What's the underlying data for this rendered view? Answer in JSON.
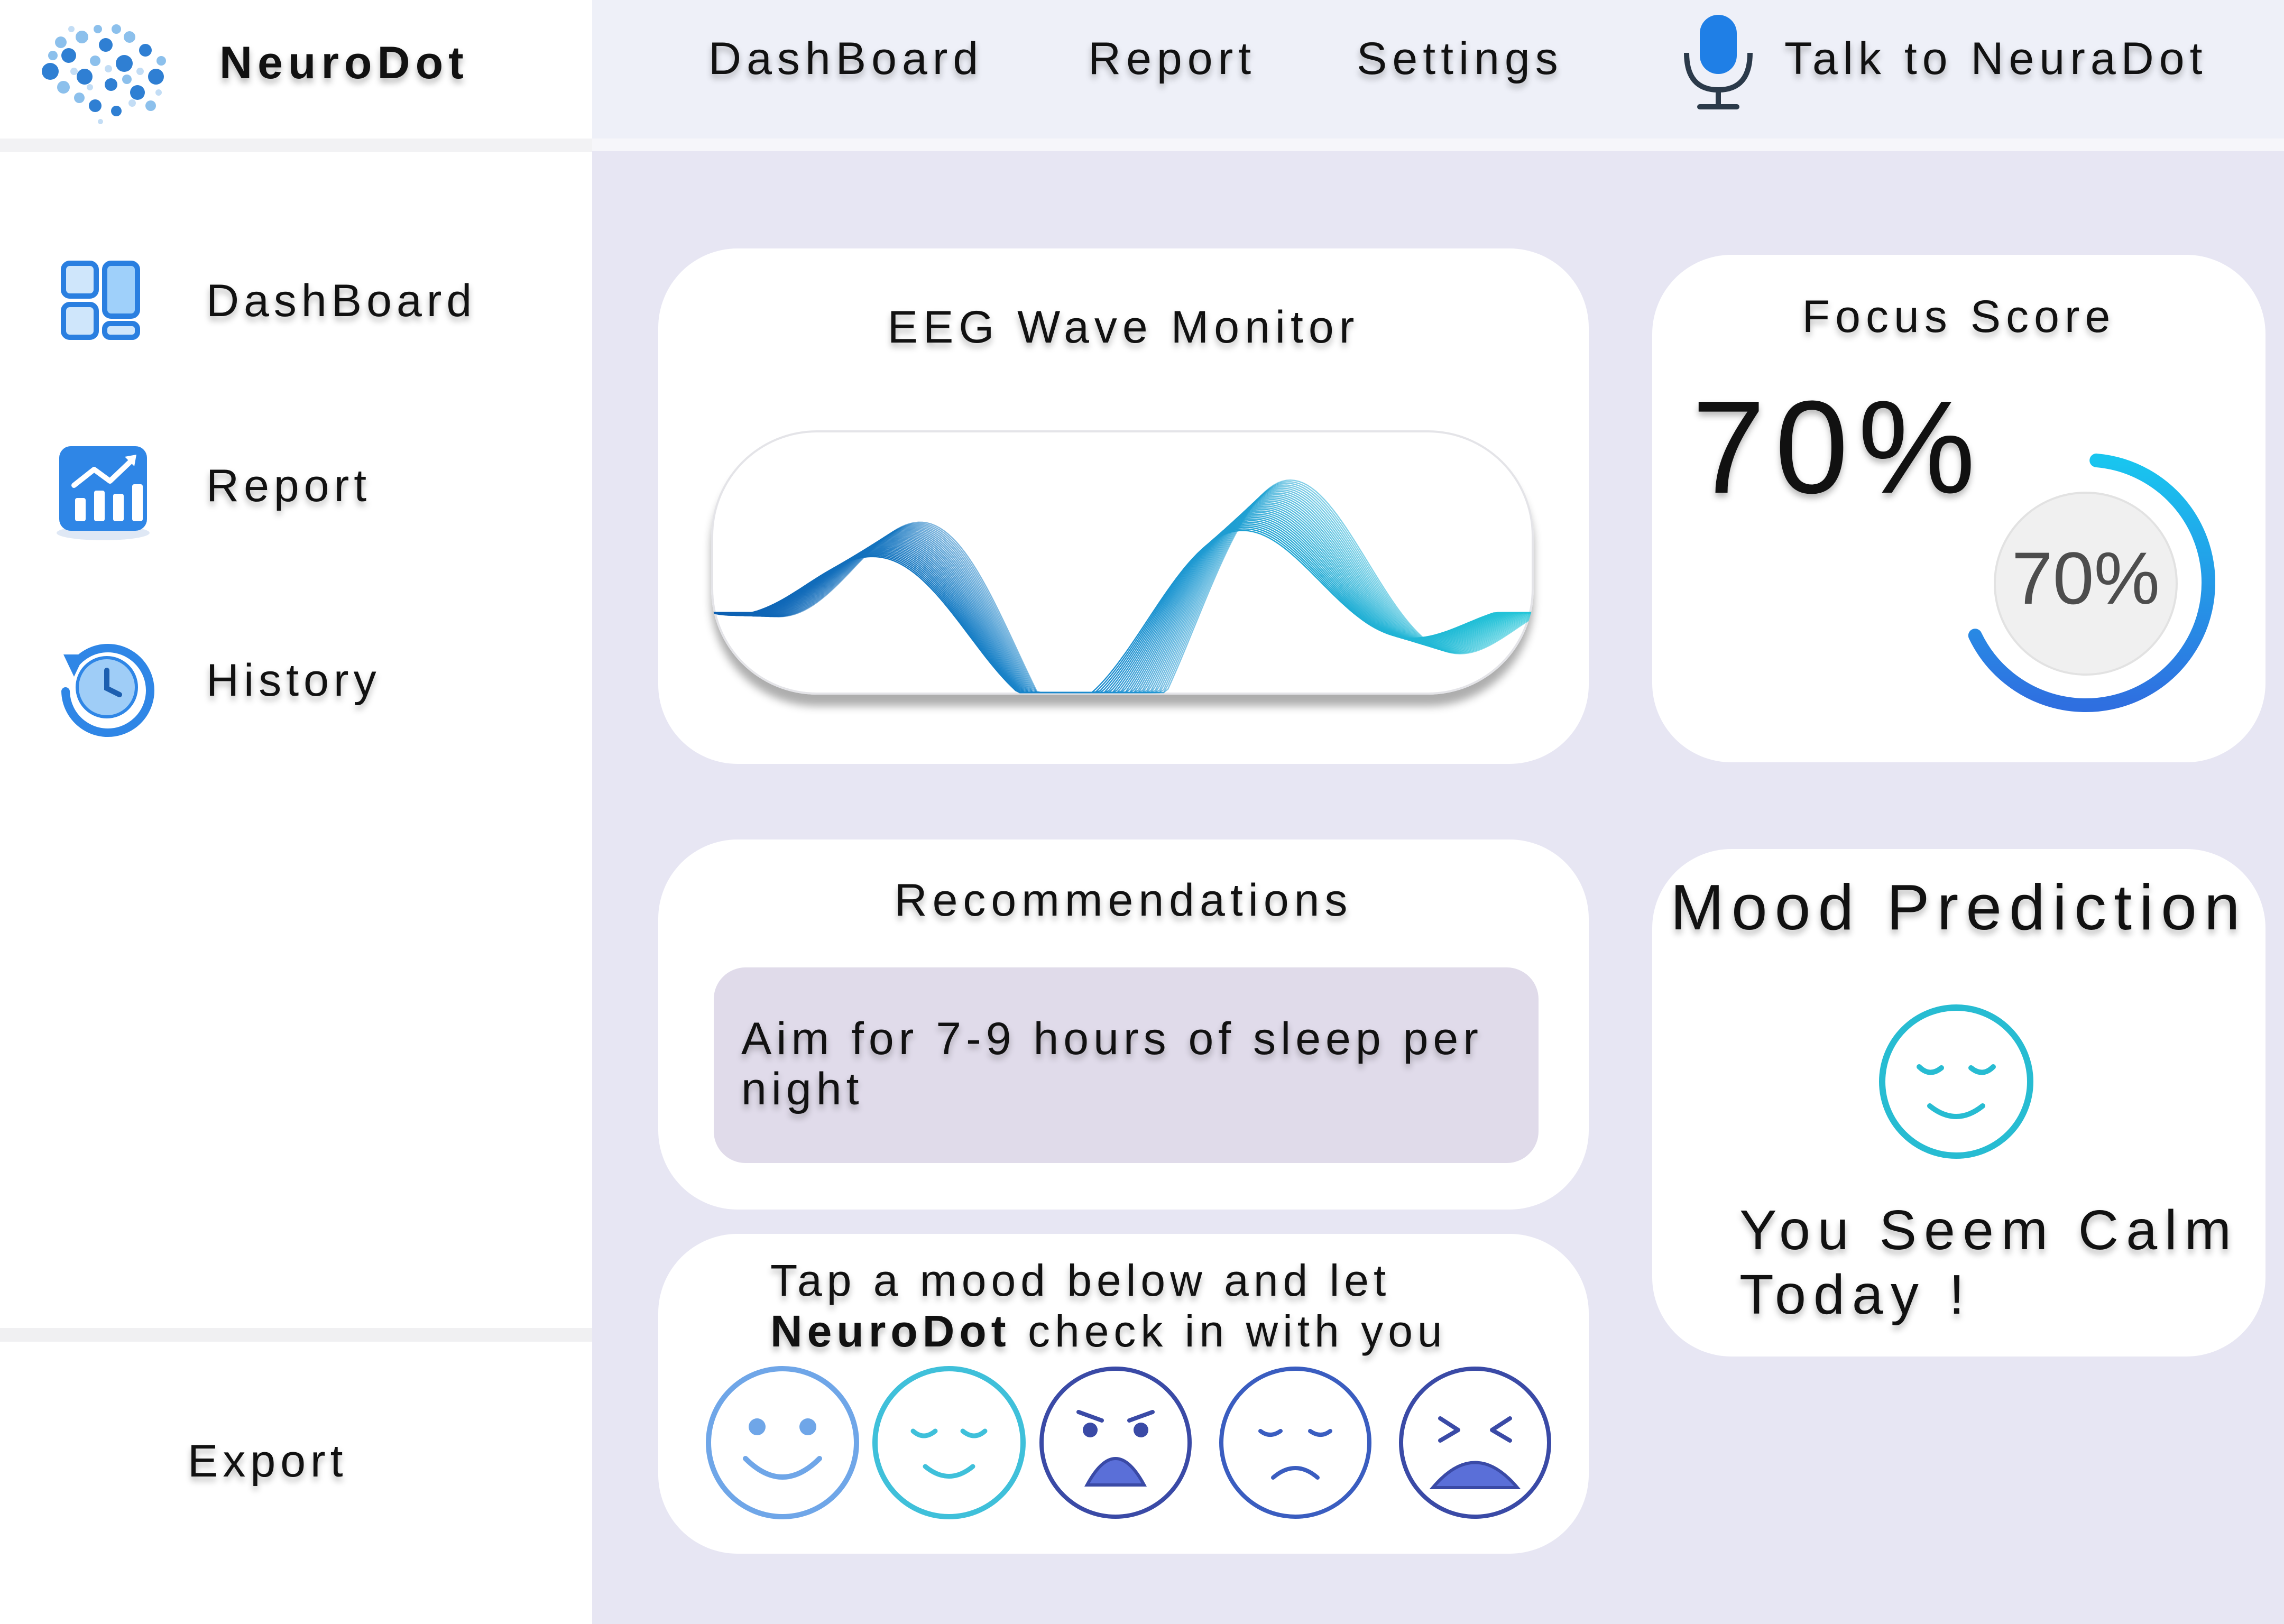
{
  "app": {
    "brand": "NeuroDot"
  },
  "topnav": {
    "items": [
      "DashBoard",
      "Report",
      "Settings"
    ],
    "talk_label": "Talk to NeuraDot"
  },
  "sidebar": {
    "items": [
      {
        "label": "DashBoard",
        "icon": "dashboard-icon"
      },
      {
        "label": "Report",
        "icon": "report-chart-icon"
      },
      {
        "label": "History",
        "icon": "history-icon"
      }
    ],
    "export_label": "Export"
  },
  "eeg": {
    "title": "EEG Wave Monitor"
  },
  "focus": {
    "title": "Focus Score",
    "value_text": "70%",
    "gauge_text": "70%",
    "value": 0.7
  },
  "recommendations": {
    "title": "Recommendations",
    "items": [
      "Aim for 7-9 hours of sleep per night"
    ]
  },
  "mood_prediction": {
    "title": "Mood Prediction",
    "icon": "calm-face-icon",
    "result": "You Seem Calm Today !"
  },
  "checkin": {
    "prompt_before": "Tap a mood below and let",
    "prompt_brand": "NeuroDot",
    "prompt_after": "check in with you",
    "moods": [
      "happy-face-icon",
      "calm-face-icon",
      "angry-face-icon",
      "sad-face-icon",
      "distressed-face-icon"
    ]
  },
  "colors": {
    "accent_blue": "#2f86e6",
    "wave_dark": "#0c5fb2",
    "wave_light": "#22c6d8",
    "calm_teal": "#27bcd2",
    "main_bg": "#e7e6f3",
    "topnav_bg": "#eef0f8",
    "rec_box": "#e0dbea"
  }
}
